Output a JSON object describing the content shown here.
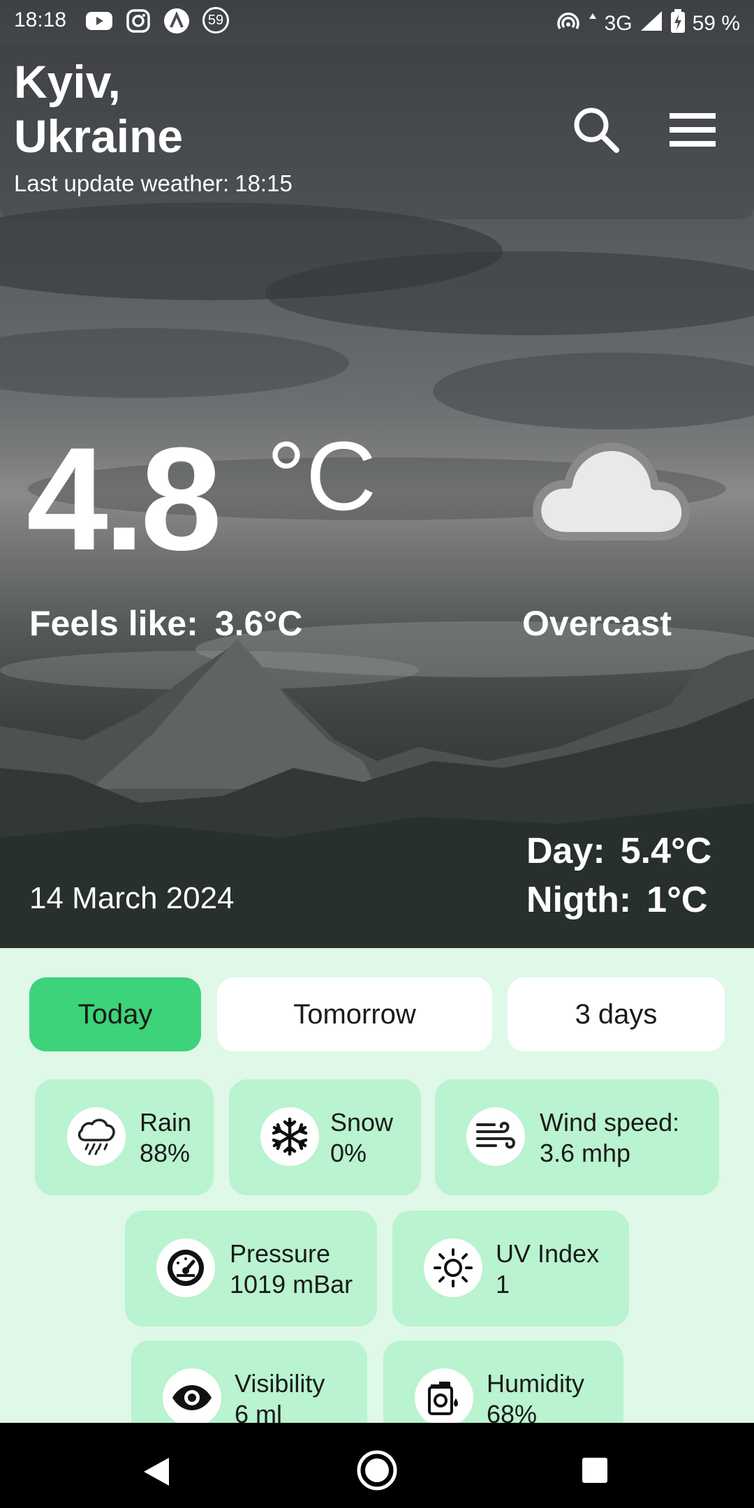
{
  "status_bar": {
    "time": "18:18",
    "notification_badge": "59",
    "network": "3G",
    "battery": "59 %"
  },
  "header": {
    "city_line1": "Kyiv,",
    "city_line2": "Ukraine",
    "last_update_label": "Last update weather:",
    "last_update_time": "18:15"
  },
  "current": {
    "temperature": "4.8",
    "unit": "°C",
    "feels_like_label": "Feels like:",
    "feels_like_value": "3.6°C",
    "condition": "Overcast",
    "date": "14 March 2024",
    "day_label": "Day:",
    "day_value": "5.4°C",
    "night_label": "Nigth:",
    "night_value": "1°C"
  },
  "tabs": [
    {
      "label": "Today",
      "active": true
    },
    {
      "label": "Tomorrow",
      "active": false
    },
    {
      "label": "3 days",
      "active": false
    }
  ],
  "details": {
    "rain": {
      "label": "Rain",
      "value": "88%",
      "icon": "rain-cloud-icon"
    },
    "snow": {
      "label": "Snow",
      "value": "0%",
      "icon": "snowflake-icon"
    },
    "wind": {
      "label": "Wind speed:",
      "value": "3.6 mhp",
      "icon": "wind-icon"
    },
    "pressure": {
      "label": "Pressure",
      "value": "1019 mBar",
      "icon": "gauge-icon"
    },
    "uv": {
      "label": "UV Index",
      "value": "1",
      "icon": "sun-icon"
    },
    "visibility": {
      "label": "Visibility",
      "value": "6 ml",
      "icon": "eye-icon"
    },
    "humidity": {
      "label": "Humidity",
      "value": "68%",
      "icon": "humidity-icon"
    }
  },
  "colors": {
    "active_tab": "#3cd37a",
    "card_bg": "#b9f3cf",
    "page_bg": "#dff8e8"
  }
}
